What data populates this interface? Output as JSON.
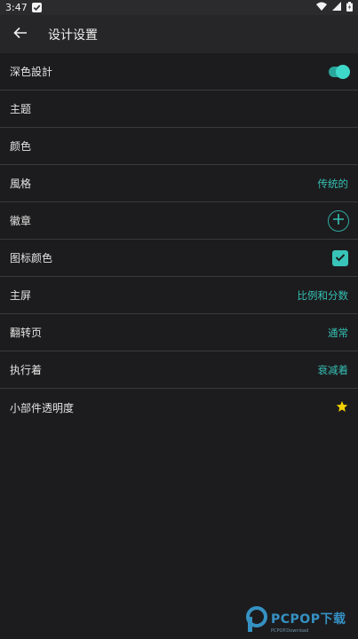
{
  "status_bar": {
    "time": "3:47"
  },
  "app_bar": {
    "title": "设计设置"
  },
  "settings": [
    {
      "label": "深色設計",
      "kind": "toggle",
      "checked": true
    },
    {
      "label": "主题",
      "kind": "none"
    },
    {
      "label": "颜色",
      "kind": "none"
    },
    {
      "label": "風格",
      "kind": "value",
      "value": "传统的"
    },
    {
      "label": "徽章",
      "kind": "add-button"
    },
    {
      "label": "图标颜色",
      "kind": "checkbox",
      "checked": true
    },
    {
      "label": "主屏",
      "kind": "value",
      "value": "比例和分数"
    },
    {
      "label": "翻转页",
      "kind": "value",
      "value": "通常"
    },
    {
      "label": "执行着",
      "kind": "value",
      "value": "衰减着"
    },
    {
      "label": "小部件透明度",
      "kind": "star"
    }
  ],
  "watermark": {
    "brand": "PCPOP下载",
    "sub": "PCPOP.Download"
  },
  "colors": {
    "accent": "#35c0b4",
    "background": "#1c1c1e",
    "appbar": "#262628",
    "star": "#f5d000"
  }
}
